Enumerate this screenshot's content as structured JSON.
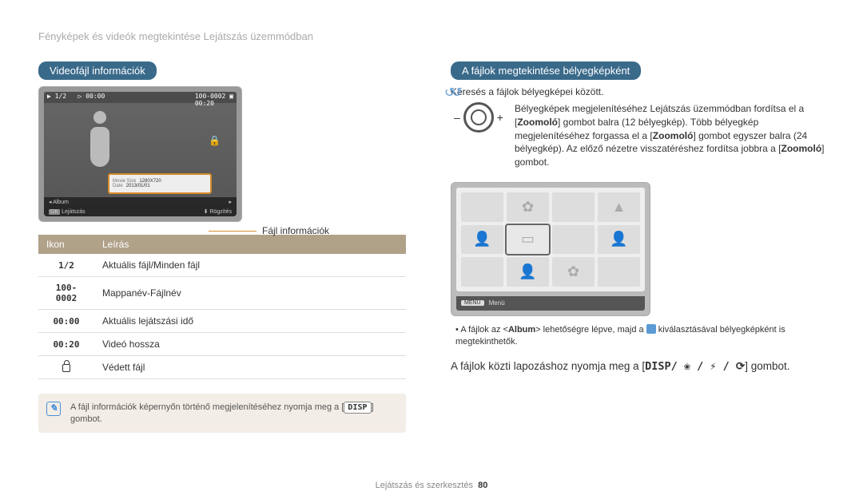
{
  "breadcrumb": "Fényképek és videók megtekintése Lejátszás üzemmódban",
  "left": {
    "header": "Videofájl információk",
    "video_top": {
      "counter": "1/2",
      "t1": "00:00",
      "folder": "100-0002",
      "t2": "00:20"
    },
    "infobox": {
      "size_l": "Movie Size",
      "size_v": "1280X720",
      "date_l": "Date",
      "date_v": "2013/01/01"
    },
    "album_row_l": "Album",
    "bottom_l_btn": "OK",
    "bottom_l_txt": "Lejátszás",
    "bottom_r_txt": "Rögzítés",
    "info_label": "Fájl információk",
    "table": {
      "h1": "Ikon",
      "h2": "Leírás",
      "rows": [
        {
          "icon": "1/2",
          "desc": "Aktuális fájl/Minden fájl"
        },
        {
          "icon": "100-0002",
          "desc": "Mappanév-Fájlnév"
        },
        {
          "icon": "00:00",
          "desc": "Aktuális lejátszási idő"
        },
        {
          "icon": "00:20",
          "desc": "Videó hossza"
        },
        {
          "icon": "lock",
          "desc": "Védett fájl"
        }
      ]
    },
    "note_pre": "A fájl információk képernyőn történő megjelenítéséhez nyomja meg a [",
    "note_btn": "DISP",
    "note_post": "] gombot."
  },
  "right": {
    "header": "A fájlok megtekintése bélyegképként",
    "subtitle": "Keresés a fájlok bélyegképei között.",
    "zoom_pre": "Bélyegképek megjelenítéséhez Lejátszás üzemmódban fordítsa el a [",
    "zoom_b1": "Zoomoló",
    "zoom_mid1": "] gombot balra (12 bélyegkép). Több bélyegkép megjelenítéséhez forgassa el a [",
    "zoom_b2": "Zoomoló",
    "zoom_mid2": "] gombot egyszer balra (24 bélyegkép). Az előző nézetre visszatéréshez fordítsa jobbra a [",
    "zoom_b3": "Zoomoló",
    "zoom_post": "] gombot.",
    "minus": "–",
    "plus": "+",
    "menu_chip": "MENU",
    "menu_label": "Menü",
    "bullet_pre": "A fájlok az <",
    "bullet_b": "Album",
    "bullet_mid": "> lehetőségre lépve, majd a ",
    "bullet_post": " kiválasztásával bélyegképként is megtekinthetők.",
    "nav_pre": "A fájlok közti lapozáshoz nyomja meg a [",
    "nav_glyphs": "DISP/ ❀ / ⚡ / ⟳",
    "nav_post": "] gombot."
  },
  "footer": {
    "section": "Lejátszás és szerkesztés",
    "page": "80"
  }
}
